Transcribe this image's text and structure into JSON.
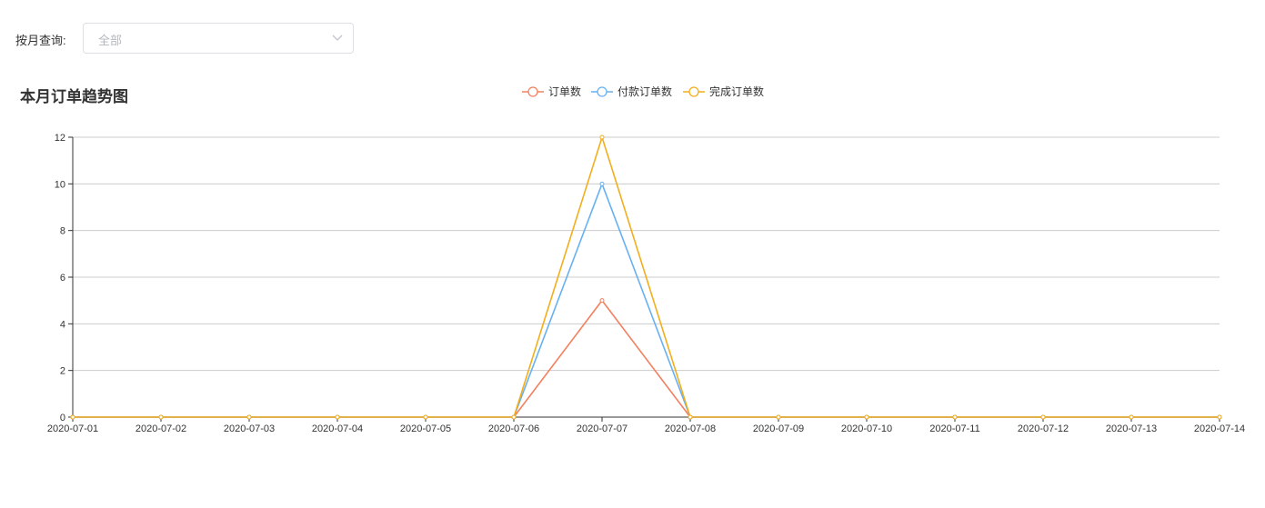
{
  "filter": {
    "label": "按月查询:",
    "select_value": "全部"
  },
  "chart_data": {
    "type": "line",
    "title": "本月订单趋势图",
    "x": [
      "2020-07-01",
      "2020-07-02",
      "2020-07-03",
      "2020-07-04",
      "2020-07-05",
      "2020-07-06",
      "2020-07-07",
      "2020-07-08",
      "2020-07-09",
      "2020-07-10",
      "2020-07-11",
      "2020-07-12",
      "2020-07-13",
      "2020-07-14"
    ],
    "ylim": [
      0,
      12
    ],
    "yticks": [
      0,
      2,
      4,
      6,
      8,
      10,
      12
    ],
    "grid": true,
    "legend_position": "top-center",
    "series": [
      {
        "name": "订单数",
        "color": "#f3805f",
        "values": [
          0,
          0,
          0,
          0,
          0,
          0,
          5,
          0,
          0,
          0,
          0,
          0,
          0,
          0
        ]
      },
      {
        "name": "付款订单数",
        "color": "#67b1f3",
        "values": [
          0,
          0,
          0,
          0,
          0,
          0,
          10,
          0,
          0,
          0,
          0,
          0,
          0,
          0
        ]
      },
      {
        "name": "完成订单数",
        "color": "#f2ae1c",
        "values": [
          0,
          0,
          0,
          0,
          0,
          0,
          12,
          0,
          0,
          0,
          0,
          0,
          0,
          0
        ]
      }
    ]
  }
}
